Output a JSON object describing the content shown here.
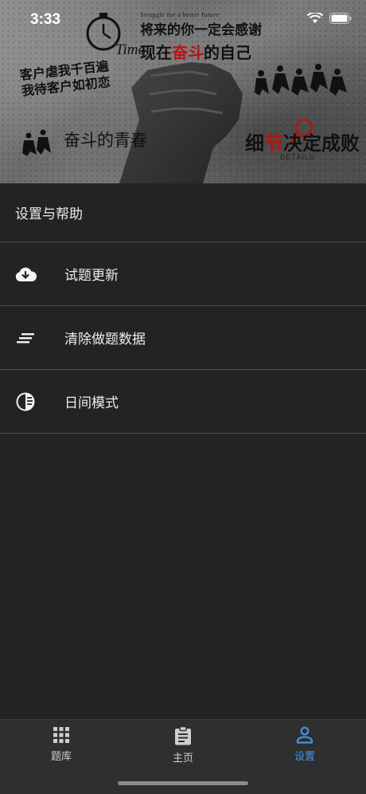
{
  "status_bar": {
    "time": "3:33"
  },
  "banner": {
    "tagline": "Struggle for a better future",
    "line1": "将来的你一定会感谢",
    "line2_prefix": "现在",
    "line2_highlight": "奋斗",
    "line2_suffix": "的自己",
    "time_word": "Time",
    "left_line1": "客户虐我千百遍",
    "left_line2": "我待客户如初恋",
    "youth_text": "奋斗的青春",
    "detail_prefix": "细",
    "detail_highlight": "节",
    "detail_suffix": "决定成败",
    "detail_en": "DETAILS"
  },
  "section": {
    "title": "设置与帮助"
  },
  "settings_items": [
    {
      "label": "试题更新",
      "icon": "cloud-download-icon"
    },
    {
      "label": "清除做题数据",
      "icon": "clear-all-icon"
    },
    {
      "label": "日间模式",
      "icon": "contrast-icon"
    }
  ],
  "tabs": [
    {
      "label": "题库",
      "icon": "grid-icon",
      "active": false
    },
    {
      "label": "主页",
      "icon": "clipboard-icon",
      "active": false
    },
    {
      "label": "设置",
      "icon": "person-icon",
      "active": true
    }
  ],
  "colors": {
    "background": "#232323",
    "tabbar": "#2f2f2f",
    "divider": "#4c4c4c",
    "accent": "#3d97ea",
    "text": "#ececec"
  }
}
